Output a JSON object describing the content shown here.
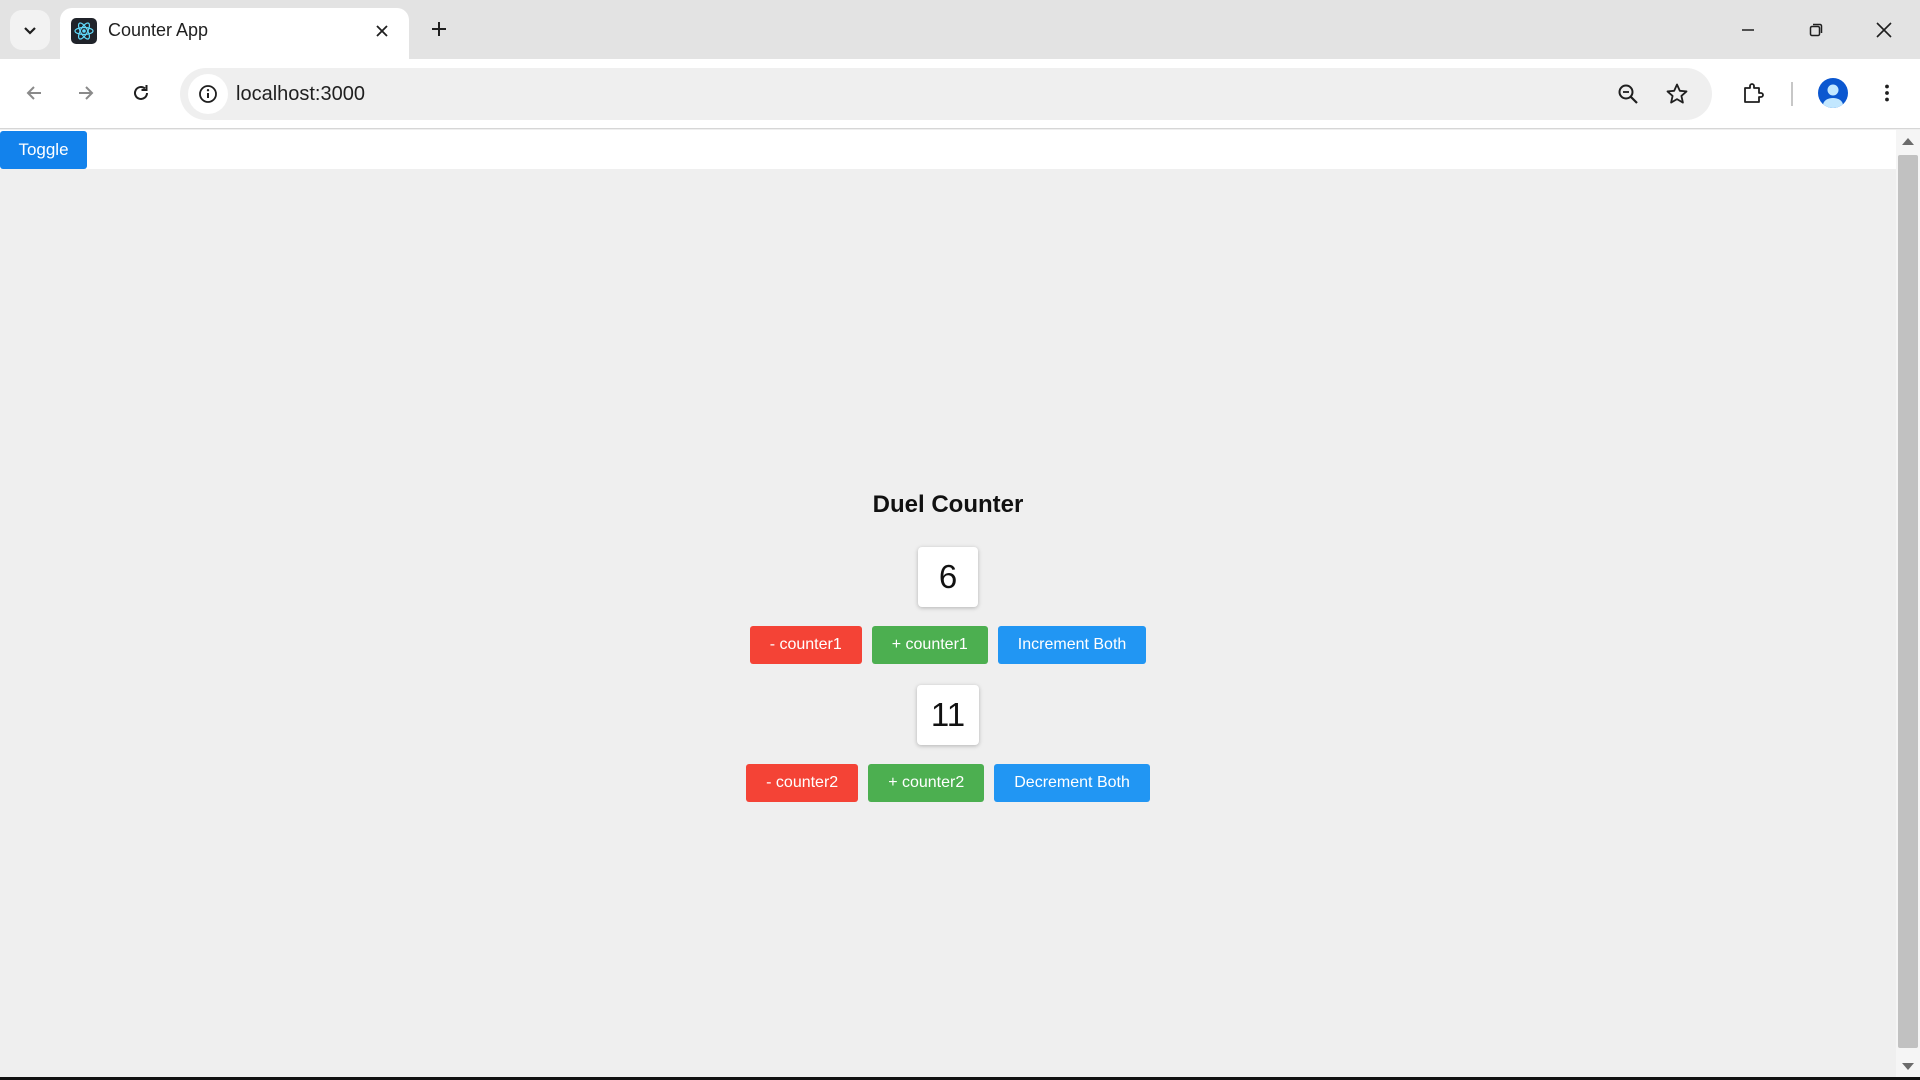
{
  "browser": {
    "tab_title": "Counter App",
    "url": "localhost:3000",
    "accent": "#0b57d0"
  },
  "icons": {
    "tab_list": "chevron-down-icon",
    "favicon": "react-atom-icon",
    "close": "close-icon",
    "new_tab": "plus-icon",
    "back": "arrow-left-icon",
    "forward": "arrow-right-icon",
    "reload": "reload-icon",
    "site_info": "info-icon",
    "zoom": "zoom-out-icon",
    "bookmark": "star-icon",
    "extensions": "puzzle-icon",
    "profile": "avatar-icon",
    "menu": "kebab-menu-icon"
  },
  "page": {
    "toggle_label": "Toggle",
    "title": "Duel Counter",
    "counter1": {
      "value": "6",
      "minus_label": "- counter1",
      "plus_label": "+ counter1",
      "both_label": "Increment Both"
    },
    "counter2": {
      "value": "11",
      "minus_label": "- counter2",
      "plus_label": "+ counter2",
      "both_label": "Decrement Both"
    }
  },
  "colors": {
    "toggle": "#1282ec",
    "decrement": "#f44336",
    "increment": "#4caf50",
    "both": "#2196f3",
    "background": "#efefef"
  }
}
